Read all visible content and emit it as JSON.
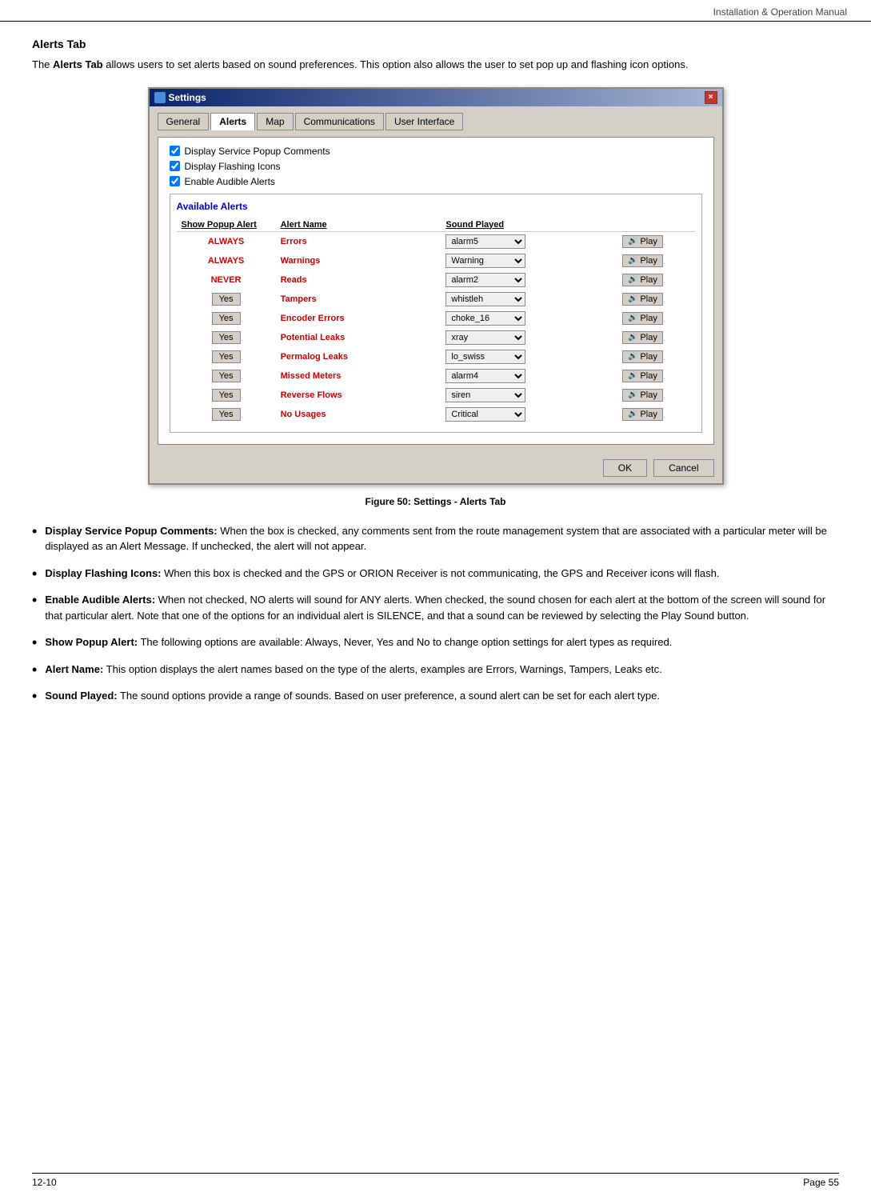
{
  "header": {
    "title": "Installation & Operation Manual"
  },
  "section": {
    "title": "Alerts Tab",
    "title_bold": "Alerts Tab",
    "intro": "The Alerts Tab allows users to set alerts based on sound preferences. This option also allows the user to set pop up  and flashing icon options."
  },
  "window": {
    "title": "Settings",
    "close_label": "×",
    "tabs": [
      {
        "label": "General",
        "active": false
      },
      {
        "label": "Alerts",
        "active": true
      },
      {
        "label": "Map",
        "active": false
      },
      {
        "label": "Communications",
        "active": false
      },
      {
        "label": "User Interface",
        "active": false
      }
    ],
    "checkboxes": [
      {
        "label": "Display Service Popup Comments",
        "checked": true
      },
      {
        "label": "Display Flashing Icons",
        "checked": true
      },
      {
        "label": "Enable Audible Alerts",
        "checked": true
      }
    ],
    "available_alerts_title": "Available Alerts",
    "table": {
      "headers": [
        "Show Popup Alert",
        "Alert Name",
        "Sound Played"
      ],
      "rows": [
        {
          "popup": "ALWAYS",
          "popup_type": "always",
          "name": "Errors",
          "sound": "alarm5"
        },
        {
          "popup": "ALWAYS",
          "popup_type": "always",
          "name": "Warnings",
          "sound": "Warning"
        },
        {
          "popup": "NEVER",
          "popup_type": "never",
          "name": "Reads",
          "sound": "alarm2"
        },
        {
          "popup": "Yes",
          "popup_type": "yes",
          "name": "Tampers",
          "sound": "whistleh"
        },
        {
          "popup": "Yes",
          "popup_type": "yes",
          "name": "Encoder Errors",
          "sound": "choke_16"
        },
        {
          "popup": "Yes",
          "popup_type": "yes",
          "name": "Potential Leaks",
          "sound": "xray"
        },
        {
          "popup": "Yes",
          "popup_type": "yes",
          "name": "Permalog Leaks",
          "sound": "lo_swiss"
        },
        {
          "popup": "Yes",
          "popup_type": "yes",
          "name": "Missed Meters",
          "sound": "alarm4"
        },
        {
          "popup": "Yes",
          "popup_type": "yes",
          "name": "Reverse Flows",
          "sound": "siren"
        },
        {
          "popup": "Yes",
          "popup_type": "yes",
          "name": "No Usages",
          "sound": "Critical"
        }
      ],
      "play_label": "Play"
    },
    "footer_buttons": [
      "OK",
      "Cancel"
    ]
  },
  "figure_caption": "Figure 50:  Settings - Alerts Tab",
  "bullets": [
    {
      "term": "Display Service Popup Comments:",
      "text": " When the box is checked, any comments sent from the route management system that are associated with a particular meter will be displayed as an Alert Message.  If unchecked, the alert will not appear."
    },
    {
      "term": "Display Flashing Icons:",
      "text": " When this box is checked and the GPS or ORION Receiver is not communicating, the GPS and Receiver icons will flash."
    },
    {
      "term": "Enable Audible Alerts:",
      "text": " When not checked, NO alerts will sound for ANY alerts.  When checked, the sound chosen for each alert at the bottom of the screen will sound for that particular alert.  Note that one of the options for an individual alert is SILENCE, and that a sound can be reviewed by selecting the Play Sound button."
    },
    {
      "term": "Show Popup Alert:",
      "text": " The following options are available: Always, Never,  Yes and No to change option settings for alert types as required."
    },
    {
      "term": "Alert Name:",
      "text": "  This option displays the alert names based on the type of the alerts, examples are Errors, Warnings, Tampers, Leaks etc."
    },
    {
      "term": "Sound Played:",
      "text": " The sound options provide a range of sounds. Based on user preference, a sound alert can be set for each alert type."
    }
  ],
  "footer": {
    "left": "12-10",
    "right": "Page 55"
  }
}
